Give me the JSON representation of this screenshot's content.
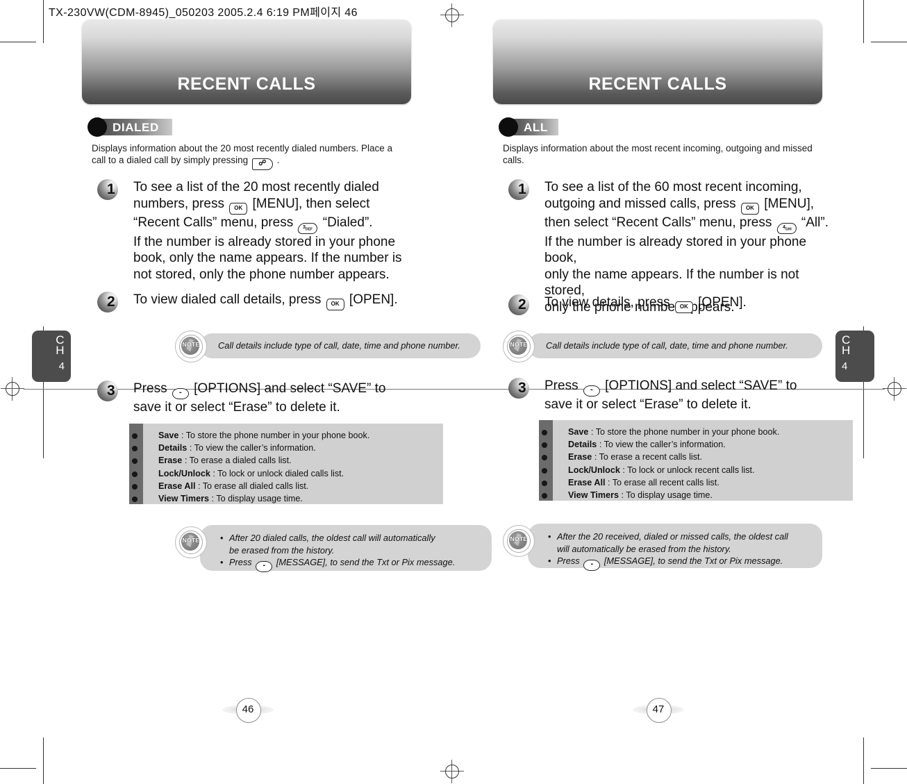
{
  "slug": "TX-230VW(CDM-8945)_050203  2005.2.4 6:19 PM페이지 46",
  "pages": [
    {
      "banner_title": "RECENT CALLS",
      "badge": "DIALED",
      "intro": "Displays information about the 20 most recently dialed numbers. Place a call to a dialed call by simply pressing",
      "intro_key": "send-key",
      "intro_tail": ".",
      "chapter_label": "CH",
      "chapter_number": "4",
      "folio": "46",
      "steps": [
        {
          "number": "1",
          "lines": [
            "To see a list of the 20 most recently dialed",
            "numbers, press [KEY:ok] [MENU], then select",
            "“Recent Calls” menu, press [KEY:3] “Dialed”.",
            "If the number is already stored in your phone",
            "book, only the name appears. If the number is",
            "not stored, only the phone number appears."
          ]
        },
        {
          "number": "2",
          "lines": [
            "To view dialed call details, press [KEY:ok] [OPEN]."
          ]
        },
        {
          "number": "3",
          "lines": [
            "Press [KEY:soft] [OPTIONS] and select “SAVE” to",
            "save it or select “Erase” to delete it."
          ]
        }
      ],
      "note_top": {
        "icon_label": "NOTE",
        "text": "Call details include type of call, date, time and phone number."
      },
      "options": [
        {
          "term": "Save",
          "desc": ": To store the phone number in your phone book."
        },
        {
          "term": "Details",
          "desc": ": To view the caller’s information."
        },
        {
          "term": "Erase",
          "desc": ": To erase a dialed calls list."
        },
        {
          "term": "Lock/Unlock",
          "desc": ": To lock or unlock dialed calls list."
        },
        {
          "term": "Erase All",
          "desc": ": To erase all dialed calls list."
        },
        {
          "term": "View Timers",
          "desc": ": To display usage time."
        }
      ],
      "note_bottom": {
        "icon_label": "NOTE",
        "items": [
          "After 20 dialed calls, the oldest call will automatically be erased from the history.",
          "Press [KEY:soft] [MESSAGE], to send the Txt or Pix message."
        ]
      }
    },
    {
      "banner_title": "RECENT CALLS",
      "badge": "ALL",
      "intro": "Displays information about the most recent incoming, outgoing and missed calls.",
      "intro_key": "",
      "intro_tail": "",
      "chapter_label": "CH",
      "chapter_number": "4",
      "folio": "47",
      "steps": [
        {
          "number": "1",
          "lines": [
            "To see a list of the 60 most recent incoming,",
            "outgoing and missed calls, press [KEY:ok] [MENU],",
            "then select “Recent Calls” menu, press [KEY:4] “All”.",
            "If the number is already stored in your phone book,",
            "only the name appears. If the number is not stored,",
            "only the phone number appears."
          ]
        },
        {
          "number": "2",
          "lines": [
            "To view details, press [KEY:ok] [OPEN]."
          ]
        },
        {
          "number": "3",
          "lines": [
            "Press [KEY:soft] [OPTIONS] and select “SAVE” to",
            "save it or select “Erase” to delete it."
          ]
        }
      ],
      "note_top": {
        "icon_label": "NOTE",
        "text": "Call details include type of call, date, time and phone number."
      },
      "options": [
        {
          "term": "Save",
          "desc": ": To store the phone number in your phone book."
        },
        {
          "term": "Details",
          "desc": ": To view the caller’s information."
        },
        {
          "term": "Erase",
          "desc": ": To erase a recent calls list."
        },
        {
          "term": "Lock/Unlock",
          "desc": ": To lock or unlock recent calls list."
        },
        {
          "term": "Erase All",
          "desc": ": To erase all recent calls list."
        },
        {
          "term": "View Timers",
          "desc": ": To display usage time."
        }
      ],
      "note_bottom": {
        "icon_label": "NOTE",
        "items": [
          "After the 20 received, dialed or missed calls, the oldest call will automatically be erased from the history.",
          "Press [KEY:soft] [MESSAGE], to send the Txt or Pix message."
        ]
      }
    }
  ],
  "keys": {
    "ok": "OK",
    "three": "3 DEF",
    "four": "4 GHI",
    "send": "⌕",
    "soft": "-"
  },
  "colors": {
    "banner_top": "#e9e9e9",
    "banner_bottom": "#4a4a4a",
    "note_bg": "#d4d4d4",
    "options_bg": "#d0d0d0",
    "options_spine": "#6b6b6b",
    "chapter_tab_bg": "#4c4c4c"
  }
}
